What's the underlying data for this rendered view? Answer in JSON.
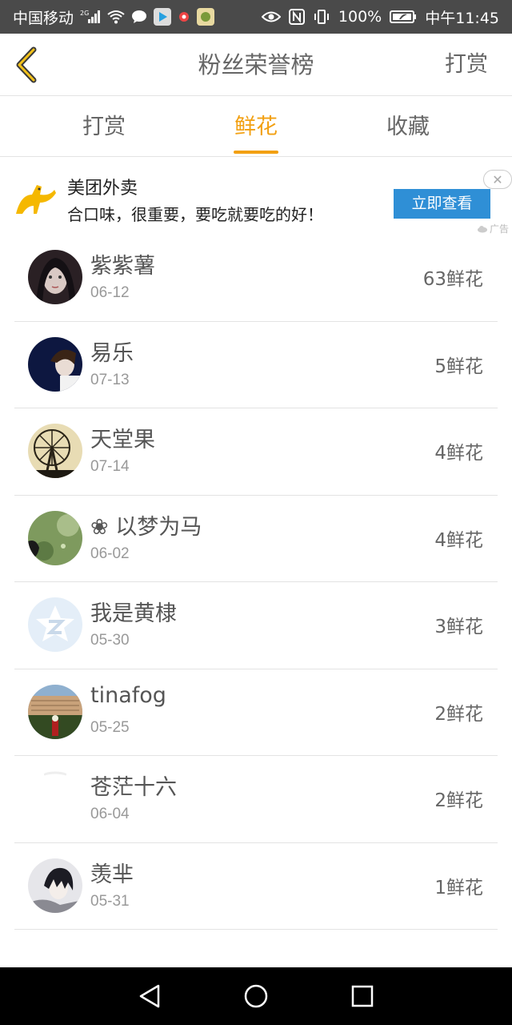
{
  "status_bar": {
    "carrier": "中国移动",
    "network": "2G",
    "battery": "100%",
    "time": "中午11:45"
  },
  "header": {
    "title": "粉丝荣誉榜",
    "action": "打赏",
    "back_icon": "chevron-left-icon"
  },
  "tabs": [
    {
      "label": "打赏",
      "active": false
    },
    {
      "label": "鲜花",
      "active": true
    },
    {
      "label": "收藏",
      "active": false
    }
  ],
  "ad": {
    "title": "美团外卖",
    "desc": "合口味，很重要，要吃就要吃的好！",
    "button": "立即查看",
    "tag": "广告",
    "close": "✕"
  },
  "fans": [
    {
      "name": "紫紫薯",
      "date": "06-12",
      "count": "63鲜花",
      "avatar": "dark-portrait"
    },
    {
      "name": "易乐",
      "date": "07-13",
      "count": "5鲜花",
      "avatar": "night-portrait"
    },
    {
      "name": "天堂果",
      "date": "07-14",
      "count": "4鲜花",
      "avatar": "ferris-wheel"
    },
    {
      "name": "❀ 以梦为马",
      "date": "06-02",
      "count": "4鲜花",
      "avatar": "green-field"
    },
    {
      "name": "我是黄棣",
      "date": "05-30",
      "count": "3鲜花",
      "avatar": "default-qq"
    },
    {
      "name": "tinafog",
      "date": "05-25",
      "count": "2鲜花",
      "avatar": "building"
    },
    {
      "name": "苍茫十六",
      "date": "06-04",
      "count": "2鲜花",
      "avatar": "blank"
    },
    {
      "name": "羡芈",
      "date": "05-31",
      "count": "1鲜花",
      "avatar": "anime-character"
    }
  ],
  "colors": {
    "accent": "#f2a012",
    "ad_button": "#2f8fd6",
    "status_bar": "#4a4a4a"
  }
}
